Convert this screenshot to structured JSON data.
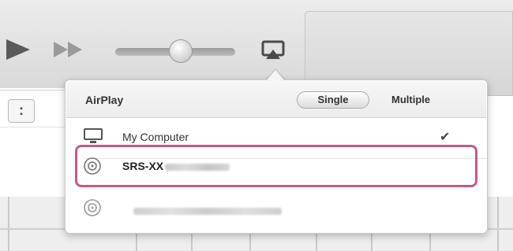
{
  "toolbar": {
    "buttons": [
      "play-icon",
      "fast-forward-icon",
      "airplay-icon"
    ],
    "volume_level": 0.56
  },
  "airplay_menu": {
    "title": "AirPlay",
    "modes": {
      "single": "Single",
      "multiple": "Multiple",
      "selected": "Single"
    },
    "devices": [
      {
        "name": "My Computer",
        "icon": "computer-icon",
        "checked": true
      },
      {
        "name": "SRS-XX",
        "name_suffix_obscured": true,
        "icon": "speaker-icon",
        "highlighted": true
      },
      {
        "name": "",
        "name_obscured": true,
        "icon": "speaker-icon"
      }
    ]
  },
  "colors": {
    "highlight_border": "#c25a8c",
    "toolbar_bg": "#dedede"
  }
}
